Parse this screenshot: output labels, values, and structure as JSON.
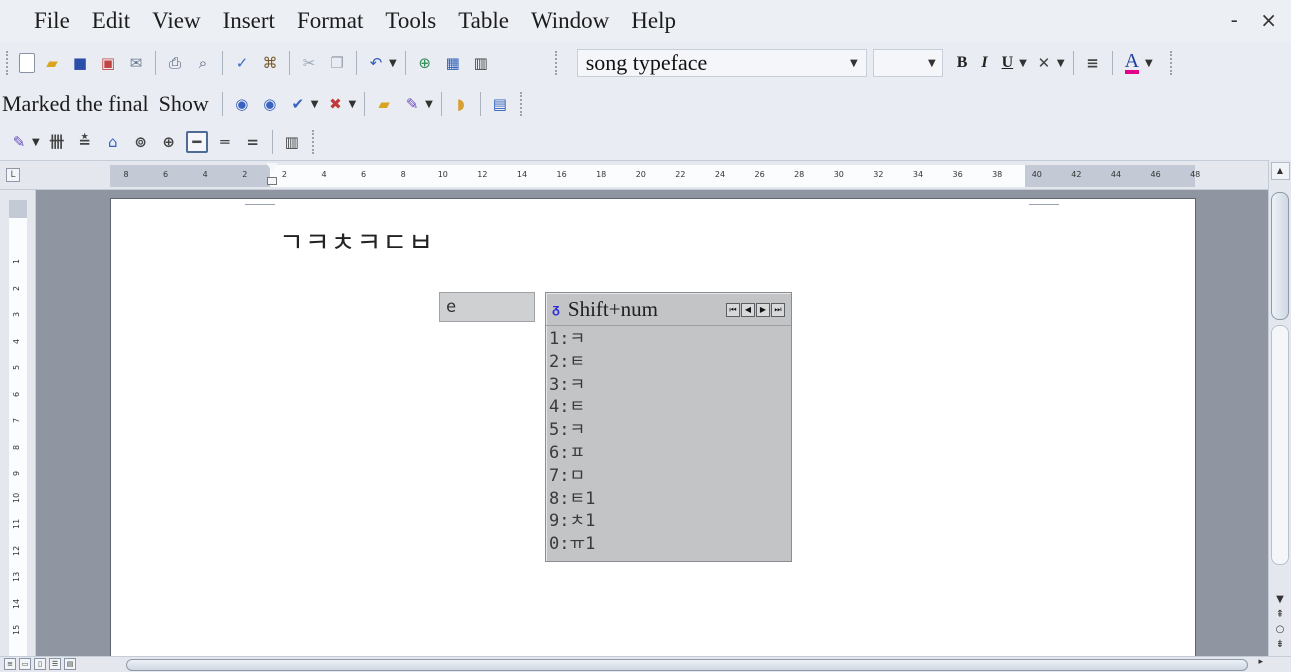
{
  "menu": {
    "items": [
      "File",
      "Edit",
      "View",
      "Insert",
      "Format",
      "Tools",
      "Table",
      "Window",
      "Help"
    ],
    "window_controls": "- ×"
  },
  "formatting": {
    "font_name": "song typeface",
    "font_size": "",
    "bold": "B",
    "italic": "I",
    "underline": "U",
    "font_color": "A"
  },
  "reviewing": {
    "display_mode": "Marked the final",
    "show_label": "Show"
  },
  "ruler": {
    "ticks": [
      "8",
      "6",
      "4",
      "2",
      "2",
      "4",
      "6",
      "8",
      "10",
      "12",
      "14",
      "16",
      "18",
      "20",
      "22",
      "24",
      "26",
      "28",
      "30",
      "32",
      "34",
      "36",
      "38",
      "40",
      "42",
      "44",
      "46",
      "48"
    ],
    "vticks": [
      "1",
      "2",
      "3",
      "4",
      "5",
      "6",
      "7",
      "8",
      "9",
      "10",
      "11",
      "12",
      "13",
      "14",
      "15"
    ]
  },
  "document": {
    "text": "ㄱㅋㅊㅋㄷㅂ"
  },
  "ime": {
    "composition": "e",
    "candidate_title": "Shift+num",
    "candidates": [
      "1:ㅋ",
      "2:ㅌ",
      "3:ㅋ",
      "4:ㅌ",
      "5:ㅋ",
      "6:ㅍ",
      "7:ㅁ",
      "8:ㅌ1",
      "9:ㅊ1",
      "0:ㅠ1"
    ],
    "nav_buttons": [
      "⏮",
      "◀",
      "▶",
      "⏭"
    ]
  },
  "colors": {
    "menu_bg": "#eceff4",
    "toolbar_bg": "#e9edf3",
    "canvas_bg": "#8f96a2",
    "candidate_bg": "#c3c4c6",
    "font_color_underline": "#e4008a"
  }
}
